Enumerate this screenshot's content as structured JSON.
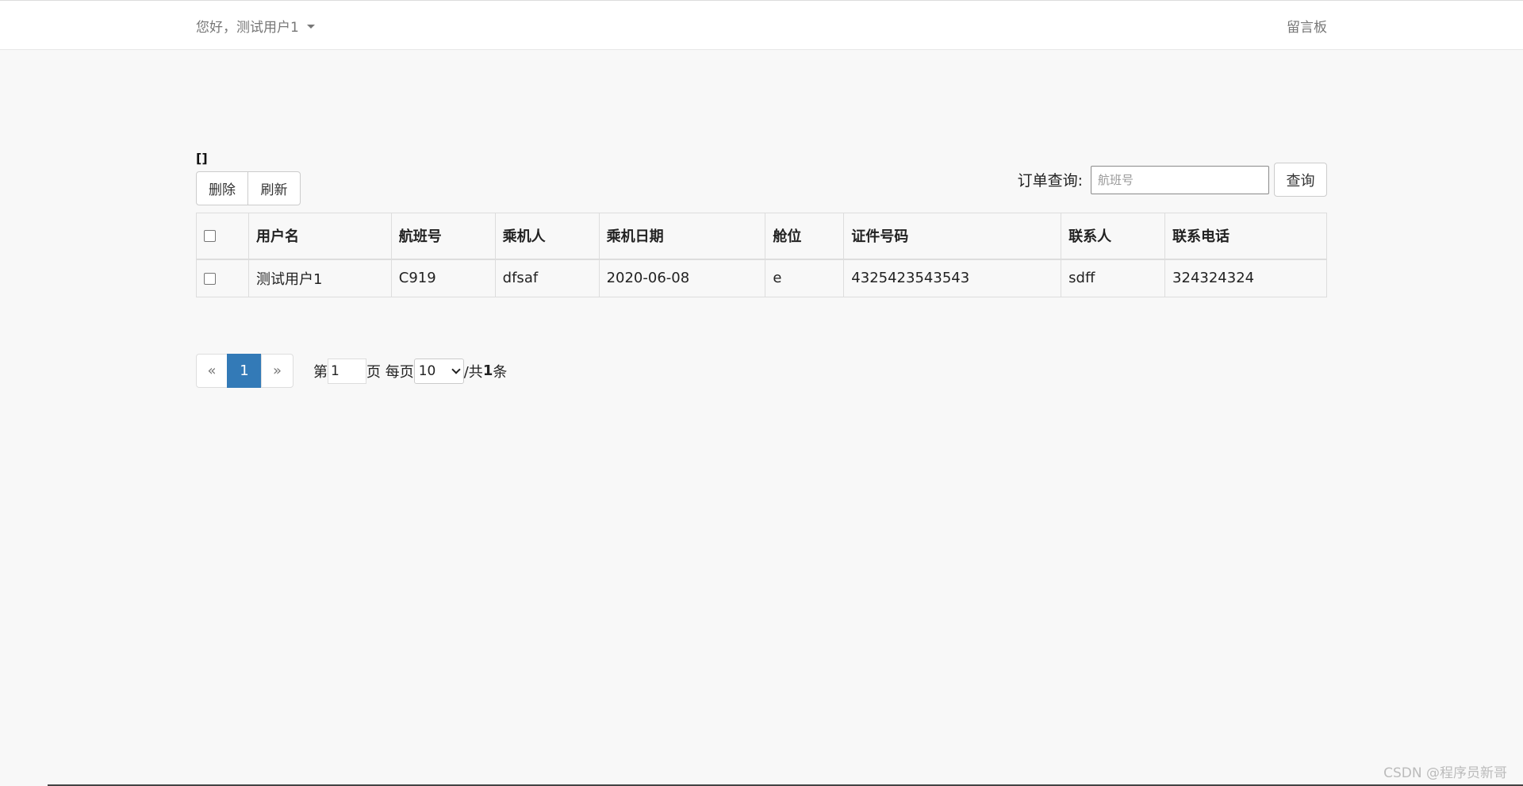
{
  "navbar": {
    "user_greeting": "您好，测试用户1",
    "right_link": "留言板"
  },
  "bracket_text": "[]",
  "toolbar": {
    "delete_label": "删除",
    "refresh_label": "刷新",
    "search_label": "订单查询:",
    "search_placeholder": "航班号",
    "search_value": "",
    "search_button": "查询"
  },
  "table": {
    "headers": [
      "用户名",
      "航班号",
      "乘机人",
      "乘机日期",
      "舱位",
      "证件号码",
      "联系人",
      "联系电话"
    ],
    "rows": [
      {
        "username": "测试用户1",
        "flight_no": "C919",
        "passenger": "dfsaf",
        "date": "2020-06-08",
        "cabin": "e",
        "id_number": "4325423543543",
        "contact": "sdff",
        "phone": "324324324"
      }
    ]
  },
  "pagination": {
    "prev": "«",
    "current": "1",
    "next": "»",
    "page_prefix": "第",
    "page_input_value": "1",
    "page_suffix": "页 每页",
    "page_size": "10",
    "total_prefix": "/共",
    "total_count": "1",
    "total_suffix": "条"
  },
  "watermark": "CSDN @程序员新哥"
}
